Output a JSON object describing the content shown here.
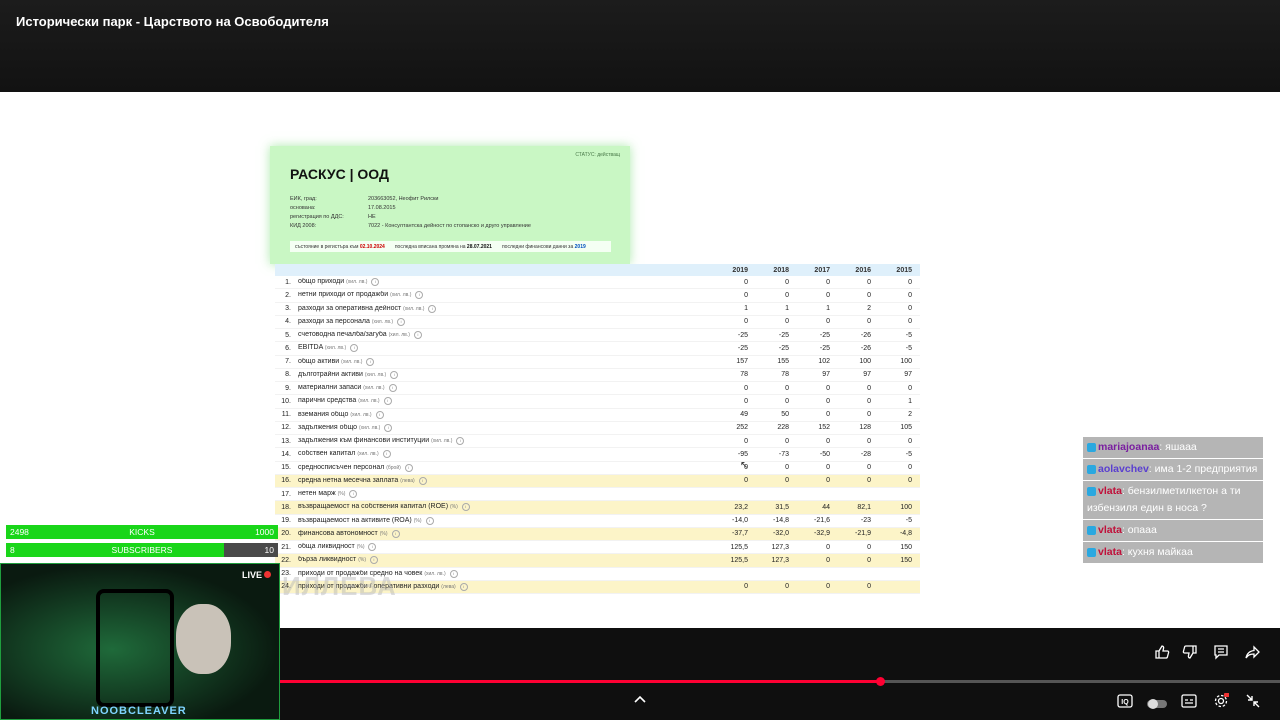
{
  "video_title": "Исторически парк - Царството на Освободителя",
  "company": {
    "status": "СТАТУС: действащ",
    "name": "РАСКУС | ООД",
    "details": [
      {
        "key": "ЕИК, град:",
        "value": "203663052, Неофит Рилски"
      },
      {
        "key": "основана:",
        "value": "17.08.2015"
      },
      {
        "key": "регистрация по ДДС:",
        "value": "НЕ"
      },
      {
        "key": "КИД 2008:",
        "value": "7022 - Консултантска дейност по стопанско и друго управление"
      }
    ],
    "footer": {
      "registry_label": "състояние в регистъра към",
      "registry_date": "02.10.2024",
      "change_label": "последна вписана промяна на",
      "change_date": "28.07.2021",
      "fin_label": "последни финансови данни за",
      "fin_year": "2019"
    }
  },
  "financials": {
    "years": [
      "2019",
      "2018",
      "2017",
      "2016",
      "2015"
    ],
    "rows": [
      {
        "n": "1.",
        "label": "общо приходи",
        "unit": "(хил. лв.)",
        "values": [
          "0",
          "0",
          "0",
          "0",
          "0"
        ]
      },
      {
        "n": "2.",
        "label": "нетни приходи от продажби",
        "unit": "(хил. лв.)",
        "values": [
          "0",
          "0",
          "0",
          "0",
          "0"
        ]
      },
      {
        "n": "3.",
        "label": "разходи за оперативна дейност",
        "unit": "(хил. лв.)",
        "values": [
          "1",
          "1",
          "1",
          "2",
          "0"
        ]
      },
      {
        "n": "4.",
        "label": "разходи за персонала",
        "unit": "(хил. лв.)",
        "values": [
          "0",
          "0",
          "0",
          "0",
          "0"
        ]
      },
      {
        "n": "5.",
        "label": "счетоводна печалба/загуба",
        "unit": "(хил. лв.)",
        "values": [
          "-25",
          "-25",
          "-25",
          "-26",
          "-5"
        ]
      },
      {
        "n": "6.",
        "label": "EBITDA",
        "unit": "(хил. лв.)",
        "values": [
          "-25",
          "-25",
          "-25",
          "-26",
          "-5"
        ]
      },
      {
        "n": "7.",
        "label": "общо активи",
        "unit": "(хил. лв.)",
        "values": [
          "157",
          "155",
          "102",
          "100",
          "100"
        ]
      },
      {
        "n": "8.",
        "label": "дълготрайни активи",
        "unit": "(хил. лв.)",
        "values": [
          "78",
          "78",
          "97",
          "97",
          "97"
        ]
      },
      {
        "n": "9.",
        "label": "материални запаси",
        "unit": "(хил. лв.)",
        "values": [
          "0",
          "0",
          "0",
          "0",
          "0"
        ]
      },
      {
        "n": "10.",
        "label": "парични средства",
        "unit": "(хил. лв.)",
        "values": [
          "0",
          "0",
          "0",
          "0",
          "1"
        ]
      },
      {
        "n": "11.",
        "label": "вземания общо",
        "unit": "(хил. лв.)",
        "values": [
          "49",
          "50",
          "0",
          "0",
          "2"
        ]
      },
      {
        "n": "12.",
        "label": "задължения общо",
        "unit": "(хил. лв.)",
        "values": [
          "252",
          "228",
          "152",
          "128",
          "105"
        ]
      },
      {
        "n": "13.",
        "label": "задължения към финансови институции",
        "unit": "(хил. лв.)",
        "values": [
          "0",
          "0",
          "0",
          "0",
          "0"
        ]
      },
      {
        "n": "14.",
        "label": "собствен капитал",
        "unit": "(хил. лв.)",
        "values": [
          "-95",
          "-73",
          "-50",
          "-28",
          "-5"
        ]
      },
      {
        "n": "15.",
        "label": "средносписъчен персонал",
        "unit": "(брой)",
        "values": [
          "0",
          "0",
          "0",
          "0",
          "0"
        ]
      },
      {
        "n": "16.",
        "label": "средна нетна месечна заплата",
        "unit": "(лева)",
        "values": [
          "0",
          "0",
          "0",
          "0",
          "0"
        ],
        "hl": true
      },
      {
        "n": "17.",
        "label": "нетен марж",
        "unit": "(%)",
        "values": [
          "",
          "",
          "",
          "",
          ""
        ]
      },
      {
        "n": "18.",
        "label": "възвращаемост на собствения капитал (ROE)",
        "unit": "(%)",
        "values": [
          "23,2",
          "31,5",
          "44",
          "82,1",
          "100"
        ],
        "hl": true
      },
      {
        "n": "19.",
        "label": "възвращаемост на активите (ROA)",
        "unit": "(%)",
        "values": [
          "-14,0",
          "-14,8",
          "-21,6",
          "-23",
          "-5"
        ]
      },
      {
        "n": "20.",
        "label": "финансова автономност",
        "unit": "(%)",
        "values": [
          "-37,7",
          "-32,0",
          "-32,9",
          "-21,9",
          "-4,8"
        ],
        "hl": true
      },
      {
        "n": "21.",
        "label": "обща ликвидност",
        "unit": "(%)",
        "values": [
          "125,5",
          "127,3",
          "0",
          "0",
          "150"
        ]
      },
      {
        "n": "22.",
        "label": "бърза ликвидност",
        "unit": "(%)",
        "values": [
          "125,5",
          "127,3",
          "0",
          "0",
          "150"
        ],
        "hl": true
      },
      {
        "n": "23.",
        "label": "приходи от продажби средно на човек",
        "unit": "(хил. лв.)",
        "values": [
          "",
          "",
          "",
          "",
          ""
        ]
      },
      {
        "n": "24.",
        "label": "приходи от продажби / оперативни разходи",
        "unit": "(лева)",
        "values": [
          "0",
          "0",
          "0",
          "0",
          ""
        ],
        "hl": true
      }
    ]
  },
  "watermark": "ИЛЛЕВА",
  "chat": [
    {
      "user": "mariajoanaa",
      "text": ": яшааа",
      "color": "#7a1fa0"
    },
    {
      "user": "aolavchev",
      "text": ": има 1-2 предприятия",
      "color": "#5a3fd0"
    },
    {
      "user": "vlata",
      "text": ": бензилметилкетон а ти избензиля един в носа ?",
      "color": "#c0103a"
    },
    {
      "user": "vlata",
      "text": ": опааа",
      "color": "#c0103a"
    },
    {
      "user": "vlata",
      "text": ": кухня майкаа",
      "color": "#c0103a"
    }
  ],
  "goals": [
    {
      "current": "2498",
      "label": "KICKS",
      "target": "1000",
      "progress": 1.0
    },
    {
      "current": "8",
      "label": "SUBSCRIBERS",
      "target": "10",
      "progress": 0.8
    }
  ],
  "webcam": {
    "live_label": "LIVE",
    "streamer_name": "NOOBCLEAVER"
  },
  "player": {
    "progress": 0.6
  },
  "icons": [
    "like-icon",
    "dislike-icon",
    "comments-icon",
    "share-icon",
    "chevron-up-icon",
    "iq-icon",
    "autoplay-toggle-icon",
    "subtitles-icon",
    "settings-icon",
    "exit-fullscreen-icon"
  ]
}
